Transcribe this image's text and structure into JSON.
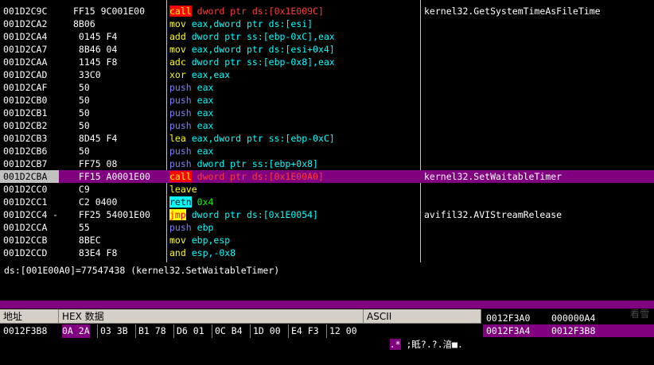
{
  "disasm": {
    "rows": [
      {
        "addr": "001D2C9C",
        "mark": "",
        "hex": "FF15 9C001E00",
        "mn": "call",
        "mnClass": "tok-call",
        "ops": "dword ptr ds:[0x1E009C]",
        "opsClass": "tok-ops-call",
        "comment": "kernel32.GetSystemTimeAsFileTime",
        "selected": false
      },
      {
        "addr": "001D2CA2",
        "mark": "",
        "hex": "8B06",
        "mn": "mov",
        "mnClass": "tok-mov",
        "ops": "eax,dword ptr ds:[esi]",
        "opsClass": "tok-ops-data",
        "comment": "",
        "selected": false
      },
      {
        "addr": "001D2CA4",
        "mark": "",
        "hex": " 0145 F4",
        "mn": "add",
        "mnClass": "tok-arith",
        "ops": "dword ptr ss:[ebp-0xC],eax",
        "opsClass": "tok-ops-data",
        "comment": "",
        "selected": false
      },
      {
        "addr": "001D2CA7",
        "mark": "",
        "hex": " 8B46 04",
        "mn": "mov",
        "mnClass": "tok-mov",
        "ops": "eax,dword ptr ds:[esi+0x4]",
        "opsClass": "tok-ops-data",
        "comment": "",
        "selected": false
      },
      {
        "addr": "001D2CAA",
        "mark": "",
        "hex": " 1145 F8",
        "mn": "adc",
        "mnClass": "tok-arith",
        "ops": "dword ptr ss:[ebp-0x8],eax",
        "opsClass": "tok-ops-data",
        "comment": "",
        "selected": false
      },
      {
        "addr": "001D2CAD",
        "mark": "",
        "hex": " 33C0",
        "mn": "xor",
        "mnClass": "tok-arith",
        "ops": "eax,eax",
        "opsClass": "tok-ops-data",
        "comment": "",
        "selected": false
      },
      {
        "addr": "001D2CAF",
        "mark": "",
        "hex": " 50",
        "mn": "push",
        "mnClass": "tok-push",
        "ops": "eax",
        "opsClass": "tok-ops-push",
        "comment": "",
        "selected": false
      },
      {
        "addr": "001D2CB0",
        "mark": "",
        "hex": " 50",
        "mn": "push",
        "mnClass": "tok-push",
        "ops": "eax",
        "opsClass": "tok-ops-push",
        "comment": "",
        "selected": false
      },
      {
        "addr": "001D2CB1",
        "mark": "",
        "hex": " 50",
        "mn": "push",
        "mnClass": "tok-push",
        "ops": "eax",
        "opsClass": "tok-ops-push",
        "comment": "",
        "selected": false
      },
      {
        "addr": "001D2CB2",
        "mark": "",
        "hex": " 50",
        "mn": "push",
        "mnClass": "tok-push",
        "ops": "eax",
        "opsClass": "tok-ops-push",
        "comment": "",
        "selected": false
      },
      {
        "addr": "001D2CB3",
        "mark": "",
        "hex": " 8D45 F4",
        "mn": "lea",
        "mnClass": "tok-mov",
        "ops": "eax,dword ptr ss:[ebp-0xC]",
        "opsClass": "tok-ops-data",
        "comment": "",
        "selected": false
      },
      {
        "addr": "001D2CB6",
        "mark": "",
        "hex": " 50",
        "mn": "push",
        "mnClass": "tok-push",
        "ops": "eax",
        "opsClass": "tok-ops-push",
        "comment": "",
        "selected": false
      },
      {
        "addr": "001D2CB7",
        "mark": "",
        "hex": " FF75 08",
        "mn": "push",
        "mnClass": "tok-push",
        "ops": "dword ptr ss:[ebp+0x8]",
        "opsClass": "tok-ops-push",
        "comment": "",
        "selected": false
      },
      {
        "addr": "001D2CBA",
        "mark": "",
        "hex": " FF15 A0001E00",
        "mn": "call",
        "mnClass": "tok-call",
        "ops": "dword ptr ds:[0x1E00A0]",
        "opsClass": "tok-ops-call",
        "comment": "kernel32.SetWaitableTimer",
        "selected": true
      },
      {
        "addr": "001D2CC0",
        "mark": "",
        "hex": " C9",
        "mn": "leave",
        "mnClass": "tok-leave",
        "ops": "",
        "opsClass": "tok-ops-data",
        "comment": "",
        "selected": false
      },
      {
        "addr": "001D2CC1",
        "mark": "",
        "hex": " C2 0400",
        "mn": "retn",
        "mnClass": "tok-retn",
        "ops": "0x4",
        "opsClass": "tok-ops-retn",
        "comment": "",
        "selected": false
      },
      {
        "addr": "001D2CC4",
        "mark": "-",
        "hex": " FF25 54001E00",
        "mn": "jmp",
        "mnClass": "tok-jmp",
        "ops": "dword ptr ds:[0x1E0054]",
        "opsClass": "tok-ops-jmp",
        "comment": "avifil32.AVIStreamRelease",
        "selected": false
      },
      {
        "addr": "001D2CCA",
        "mark": "",
        "hex": " 55",
        "mn": "push",
        "mnClass": "tok-push",
        "ops": "ebp",
        "opsClass": "tok-ops-push",
        "comment": "",
        "selected": false
      },
      {
        "addr": "001D2CCB",
        "mark": "",
        "hex": " 8BEC",
        "mn": "mov",
        "mnClass": "tok-mov",
        "ops": "ebp,esp",
        "opsClass": "tok-ops-data",
        "comment": "",
        "selected": false
      },
      {
        "addr": "001D2CCD",
        "mark": "",
        "hex": " 83E4 F8",
        "mn": "and",
        "mnClass": "tok-arith",
        "ops": "esp,-0x8",
        "opsClass": "tok-ops-data",
        "comment": "",
        "selected": false
      }
    ]
  },
  "info": {
    "line": "ds:[001E00A0]=77547438 (kernel32.SetWaitableTimer)"
  },
  "dump": {
    "header_addr": "地址",
    "header_hex": "HEX 数据",
    "header_ascii": "ASCII",
    "row_addr": "0012F3B8",
    "bytes": [
      "0A 2A",
      "03 3B",
      "B1 78",
      "D6 01",
      "0C B4",
      "1D 00",
      "E4 F3",
      "12 00"
    ],
    "ascii": ".* ;眡?.?.湆■."
  },
  "stack": {
    "rows": [
      {
        "addr": "0012F3A0",
        "value": "000000A4",
        "selected": false
      },
      {
        "addr": "0012F3A4",
        "value": "0012F3B8",
        "selected": true
      }
    ]
  },
  "watermark": "看雪"
}
